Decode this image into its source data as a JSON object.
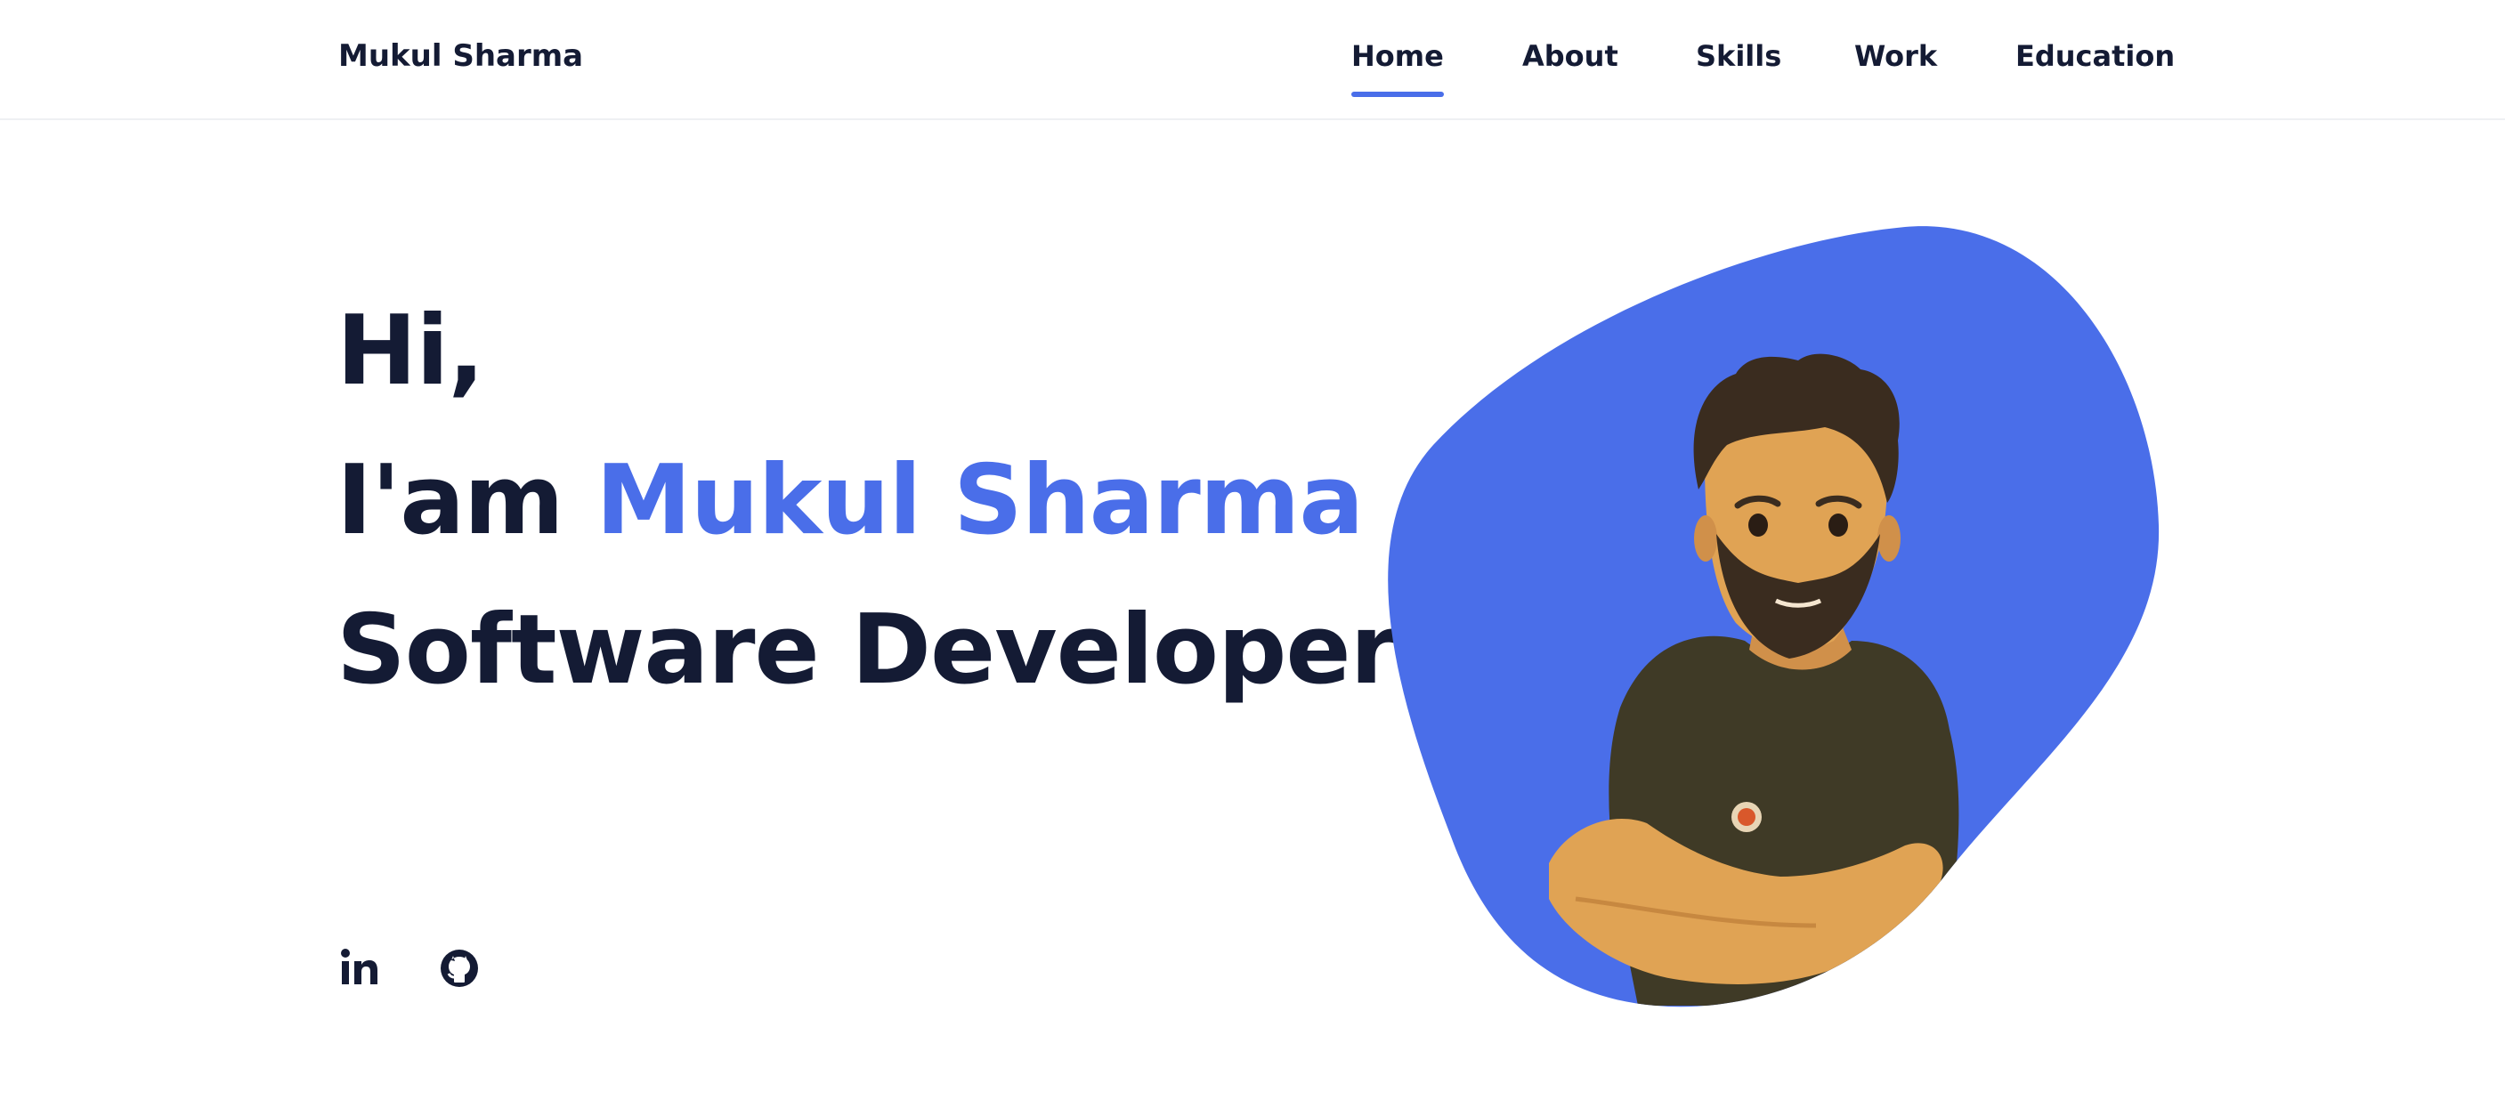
{
  "header": {
    "logo": "Mukul Sharma",
    "nav": [
      {
        "label": "Home",
        "active": true
      },
      {
        "label": "About",
        "active": false
      },
      {
        "label": "Skills",
        "active": false
      },
      {
        "label": "Work",
        "active": false
      },
      {
        "label": "Education",
        "active": false
      }
    ]
  },
  "hero": {
    "greeting": "Hi,",
    "intro": "I'am",
    "name": "Mukul Sharma",
    "role": "Software Developer"
  },
  "social": [
    {
      "icon": "linkedin-icon"
    },
    {
      "icon": "github-icon"
    }
  ],
  "colors": {
    "accent": "#4a6ee9",
    "text": "#141b34",
    "blob": "#4a6ee9",
    "shirt": "#3f3a26",
    "skin": "#e0a354",
    "hair": "#3a2c1f"
  }
}
